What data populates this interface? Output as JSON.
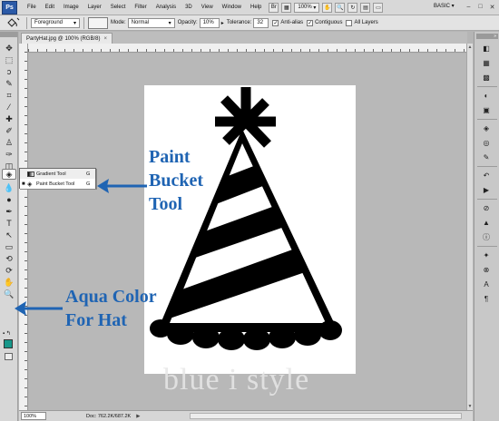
{
  "app": {
    "logo": "Ps"
  },
  "menubar": {
    "items": [
      "File",
      "Edit",
      "Image",
      "Layer",
      "Select",
      "Filter",
      "Analysis",
      "3D",
      "View",
      "Window",
      "Help"
    ],
    "zoom": "100%",
    "workspace": "BASIC ▾",
    "window_min": "–",
    "window_max": "□",
    "window_close": "✕"
  },
  "options": {
    "fill_source": "Foreground",
    "mode_label": "Mode:",
    "mode_value": "Normal",
    "opacity_label": "Opacity:",
    "opacity_value": "10%",
    "tolerance_label": "Tolerance:",
    "tolerance_value": "32",
    "antialias_label": "Anti-alias",
    "contiguous_label": "Contiguous",
    "all_layers_label": "All Layers",
    "antialias_checked": true,
    "contiguous_checked": true,
    "all_layers_checked": false
  },
  "document": {
    "tab_title": "PartyHat.jpg @ 100% (RGB/8)",
    "tab_close": "×"
  },
  "status": {
    "zoom": "100%",
    "doc_info": "Doc: 762.2K/687.2K",
    "arrow": "▶"
  },
  "flyout": {
    "items": [
      {
        "label": "Gradient Tool",
        "shortcut": "G",
        "selected": false
      },
      {
        "label": "Paint Bucket Tool",
        "shortcut": "G",
        "selected": true
      }
    ]
  },
  "toolbox": {
    "foreground_color": "#17978a"
  },
  "annotations": {
    "paint_bucket": [
      "Paint",
      "Bucket",
      "Tool"
    ],
    "aqua": [
      "Aqua Color",
      "For Hat"
    ],
    "color": "#1f64b3"
  },
  "watermark": "blue i style"
}
